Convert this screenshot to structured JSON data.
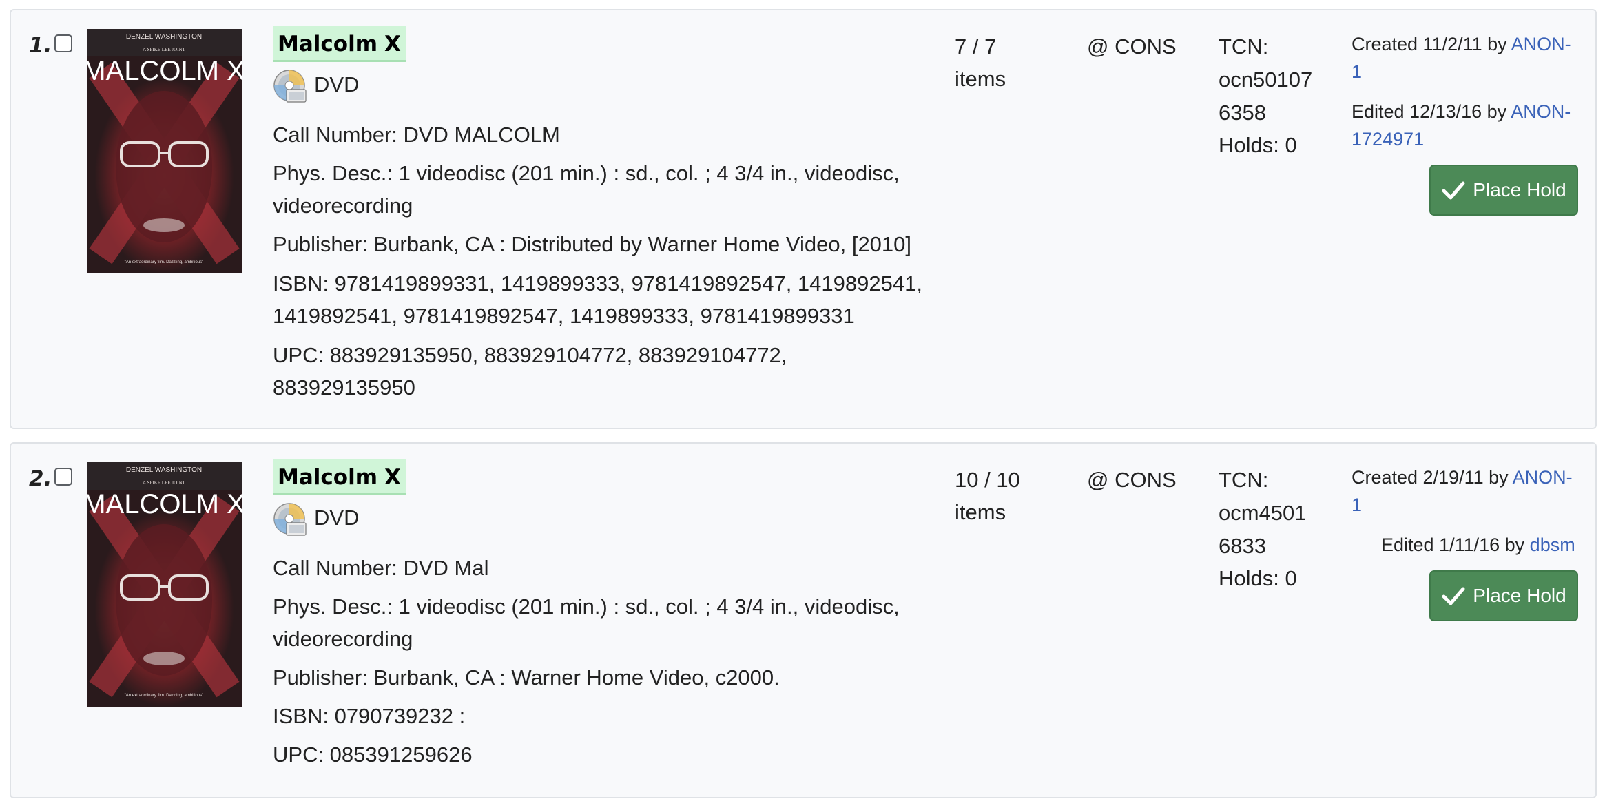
{
  "results": [
    {
      "number": "1.",
      "cover_lines": {
        "actor": "DENZEL WASHINGTON",
        "film": "A SPIKE LEE JOINT",
        "title": "MALCOLM X",
        "quote": "\"An extraordinary film. Dazzling, ambitious\""
      },
      "title_words": [
        "Malcolm",
        "X"
      ],
      "format": {
        "icon": "dvd-disc-icon",
        "label": "DVD"
      },
      "call_number": "Call Number: DVD MALCOLM",
      "phys_desc": [
        "Phys. Desc.: 1 videodisc (201 min.) : sd., col. ; 4 3/4 in., videodisc,",
        "videorecording"
      ],
      "publisher": [
        "Publisher: Burbank, CA : Distributed by Warner Home Video, [2010]"
      ],
      "isbn": [
        "ISBN: 9781419899331, 1419899333, 9781419892547, 1419892541,",
        "1419892541, 9781419892547, 1419899333, 9781419899331"
      ],
      "upc": [
        "UPC: 883929135950, 883929104772, 883929104772,",
        "883929135950"
      ],
      "items": [
        "7 / 7",
        "items"
      ],
      "location": "@ CONS",
      "tcn": [
        "TCN:",
        "ocn50107",
        "6358"
      ],
      "holds": "Holds: 0",
      "created_prefix": "Created 11/2/11 by ",
      "created_by": [
        "ANON-",
        "1"
      ],
      "edited_prefix": "Edited 12/13/16 by ",
      "edited_by": [
        "ANON-",
        "1724971"
      ],
      "hold_button": "Place Hold"
    },
    {
      "number": "2.",
      "cover_lines": {
        "actor": "DENZEL WASHINGTON",
        "film": "A SPIKE LEE JOINT",
        "title": "MALCOLM X",
        "quote": "\"An extraordinary film. Dazzling, ambitious\""
      },
      "title_words": [
        "Malcolm",
        "X"
      ],
      "format": {
        "icon": "dvd-disc-icon",
        "label": "DVD"
      },
      "call_number": "Call Number: DVD Mal",
      "phys_desc": [
        "Phys. Desc.: 1 videodisc (201 min.) : sd., col. ; 4 3/4 in., videodisc,",
        "videorecording"
      ],
      "publisher": [
        "Publisher: Burbank, CA : Warner Home Video, c2000."
      ],
      "isbn": [
        "ISBN: 0790739232 :"
      ],
      "upc": [
        "UPC: 085391259626"
      ],
      "items": [
        "10 / 10",
        "items"
      ],
      "location": "@ CONS",
      "tcn": [
        "TCN:",
        "ocm4501",
        "6833"
      ],
      "holds": "Holds: 0",
      "created_prefix": "Created 2/19/11 by ",
      "created_by": [
        "ANON-",
        "1"
      ],
      "edited_prefix": "Edited 1/11/16 by ",
      "edited_by": [
        "dbsm"
      ],
      "hold_button": "Place Hold"
    }
  ],
  "colors": {
    "title_highlight": "#d0f5d8",
    "button": "#4c8a57",
    "link": "#3a62b8"
  }
}
